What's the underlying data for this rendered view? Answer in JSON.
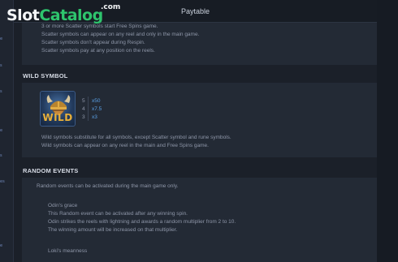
{
  "header": {
    "title": "Paytable"
  },
  "watermark": {
    "slot": "Slot",
    "catalog": "Catalog",
    "com": ".com",
    "brand_color": "#2ec46d"
  },
  "left_rail": {
    "items": [
      "e",
      "s",
      "s",
      "e",
      "s",
      "e",
      "es"
    ]
  },
  "scatter_section": {
    "lines": [
      "3 or more Scatter symbols start Free Spins game.",
      "Scatter symbols can appear on any reel and only in the main game.",
      "Scatter symbols don't appear during Respin.",
      "Scatter symbols pay at any position on the reels."
    ]
  },
  "wild_section": {
    "title": "WILD SYMBOL",
    "symbol_icon": "viking-wild-icon",
    "symbol_word": "WILD",
    "pays": [
      {
        "count": "5",
        "mult": "x50"
      },
      {
        "count": "4",
        "mult": "x7.5"
      },
      {
        "count": "3",
        "mult": "x3"
      }
    ],
    "lines": [
      "Wild symbols substitute for all symbols, except Scatter symbol and rune symbols.",
      "Wild symbols can appear on any reel in the main and Free Spins game."
    ]
  },
  "random_section": {
    "title": "RANDOM EVENTS",
    "intro": "Random events can be activated during the main game only.",
    "odins_grace": {
      "title": "Odin's grace",
      "lines": [
        "This Random event can be activated after any winning spin.",
        "Odin strikes the reels with lightning and awards a random multiplier from 2 to 10.",
        "The winning amount will be increased on that multiplier."
      ]
    },
    "lokis_meanness": {
      "title": "Loki's meanness"
    }
  }
}
